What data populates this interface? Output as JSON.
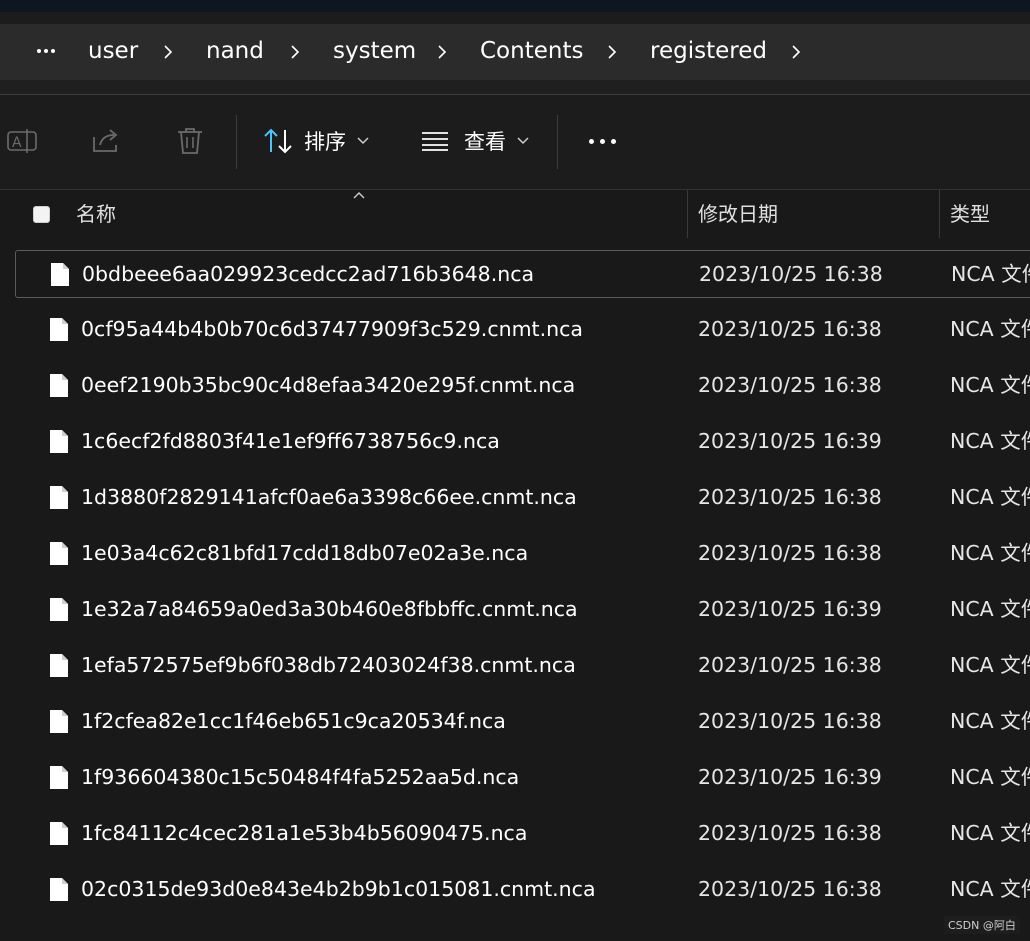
{
  "breadcrumb": {
    "more_icon": "ellipsis-icon",
    "items": [
      "user",
      "nand",
      "system",
      "Contents",
      "registered"
    ]
  },
  "toolbar": {
    "rename_icon": "rename-icon",
    "share_icon": "share-icon",
    "delete_icon": "trash-icon",
    "sort_label": "排序",
    "view_label": "查看",
    "more_icon": "ellipsis-icon"
  },
  "columns": {
    "name": "名称",
    "date": "修改日期",
    "type": "类型"
  },
  "files": [
    {
      "name": "0bdbeee6aa029923cedcc2ad716b3648.nca",
      "date": "2023/10/25 16:38",
      "type": "NCA 文件"
    },
    {
      "name": "0cf95a44b4b0b70c6d37477909f3c529.cnmt.nca",
      "date": "2023/10/25 16:38",
      "type": "NCA 文件"
    },
    {
      "name": "0eef2190b35bc90c4d8efaa3420e295f.cnmt.nca",
      "date": "2023/10/25 16:38",
      "type": "NCA 文件"
    },
    {
      "name": "1c6ecf2fd8803f41e1ef9ff6738756c9.nca",
      "date": "2023/10/25 16:39",
      "type": "NCA 文件"
    },
    {
      "name": "1d3880f2829141afcf0ae6a3398c66ee.cnmt.nca",
      "date": "2023/10/25 16:38",
      "type": "NCA 文件"
    },
    {
      "name": "1e03a4c62c81bfd17cdd18db07e02a3e.nca",
      "date": "2023/10/25 16:38",
      "type": "NCA 文件"
    },
    {
      "name": "1e32a7a84659a0ed3a30b460e8fbbffc.cnmt.nca",
      "date": "2023/10/25 16:39",
      "type": "NCA 文件"
    },
    {
      "name": "1efa572575ef9b6f038db72403024f38.cnmt.nca",
      "date": "2023/10/25 16:38",
      "type": "NCA 文件"
    },
    {
      "name": "1f2cfea82e1cc1f46eb651c9ca20534f.nca",
      "date": "2023/10/25 16:38",
      "type": "NCA 文件"
    },
    {
      "name": "1f936604380c15c50484f4fa5252aa5d.nca",
      "date": "2023/10/25 16:39",
      "type": "NCA 文件"
    },
    {
      "name": "1fc84112c4cec281a1e53b4b56090475.nca",
      "date": "2023/10/25 16:38",
      "type": "NCA 文件"
    },
    {
      "name": "02c0315de93d0e843e4b2b9b1c015081.cnmt.nca",
      "date": "2023/10/25 16:38",
      "type": "NCA 文件"
    }
  ],
  "watermark": "CSDN @阿白"
}
